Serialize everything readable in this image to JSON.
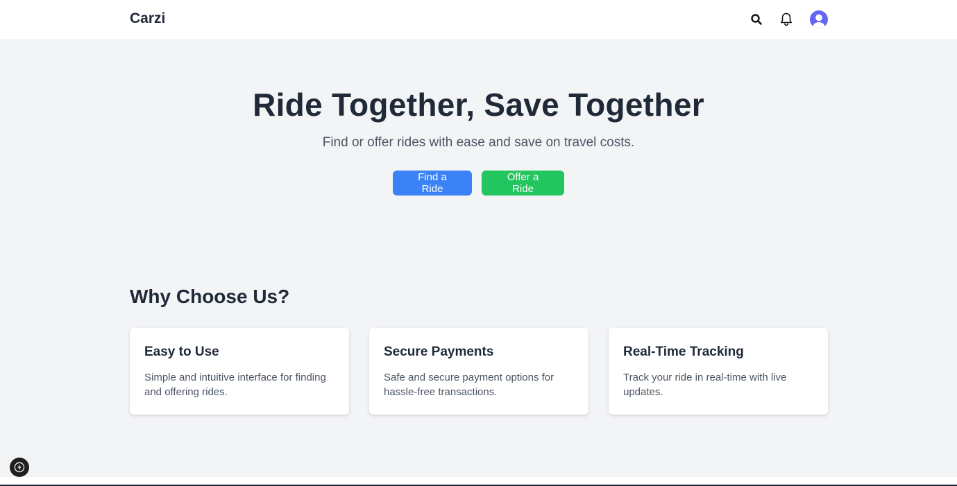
{
  "header": {
    "brand": "Carzi",
    "icons": [
      "search-icon",
      "bell-icon",
      "user-avatar-icon"
    ]
  },
  "hero": {
    "title": "Ride Together, Save Together",
    "subtitle": "Find or offer rides with ease and save on travel costs.",
    "find_label": "Find a Ride",
    "offer_label": "Offer a Ride"
  },
  "features": {
    "title": "Why Choose Us?",
    "cards": [
      {
        "title": "Easy to Use",
        "text": "Simple and intuitive interface for finding and offering rides."
      },
      {
        "title": "Secure Payments",
        "text": "Safe and secure payment options for hassle-free transactions."
      },
      {
        "title": "Real-Time Tracking",
        "text": "Track your ride in real-time with live updates."
      }
    ]
  },
  "colors": {
    "primary_blue": "#3b82f6",
    "primary_green": "#22c55e",
    "avatar": "#6366f1",
    "page_bg": "#f3f4f6"
  }
}
